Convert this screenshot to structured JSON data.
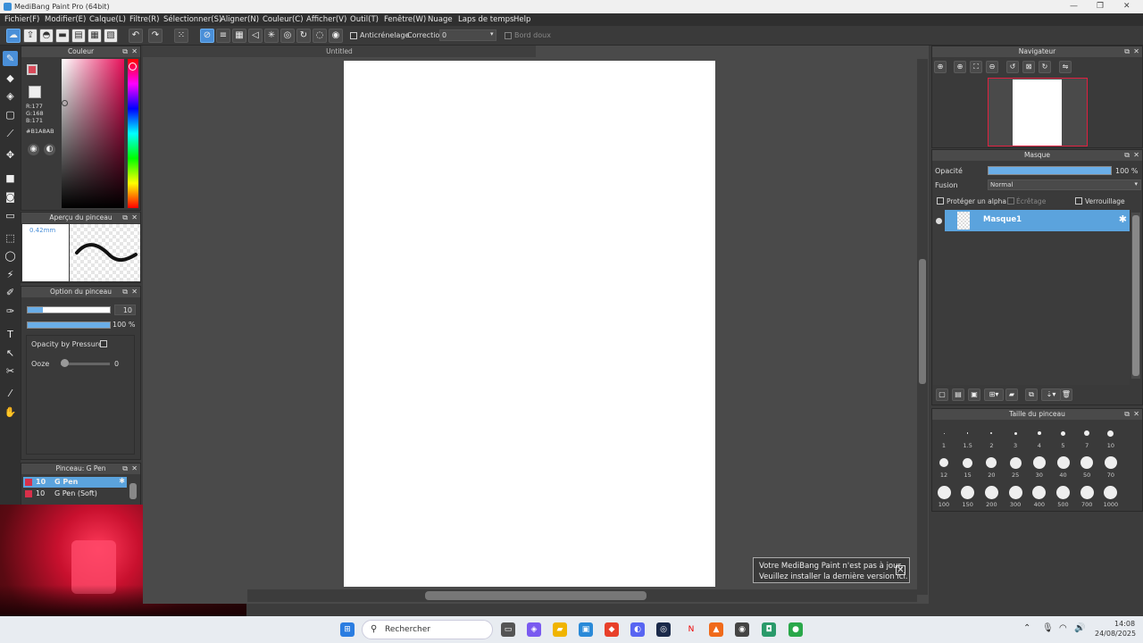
{
  "window": {
    "title": "MediBang Paint Pro (64bit)",
    "minimize": "—",
    "maximize": "❐",
    "close": "✕"
  },
  "menu": [
    "Fichier(F)",
    "Modifier(E)",
    "Calque(L)",
    "Filtre(R)",
    "Sélectionner(S)",
    "Aligner(N)",
    "Couleur(C)",
    "Afficher(V)",
    "Outil(T)",
    "Fenêtre(W)",
    "Nuage",
    "Laps de temps",
    "Help"
  ],
  "toolbar": {
    "antialias_label": "Anticrénelage",
    "correction_label": "Correction",
    "correction_value": "0",
    "soft_edge_label": "Bord doux"
  },
  "document": {
    "tab_title": "Untitled"
  },
  "color_panel": {
    "title": "Couleur",
    "r": "R:177",
    "g": "G:168",
    "b": "B:171",
    "hex": "#B1A8AB",
    "accent": "#4a8fd8"
  },
  "brush_preview": {
    "title": "Aperçu du pinceau",
    "size": "0.42mm"
  },
  "brush_option": {
    "title": "Option du pinceau",
    "size_value": "10",
    "opacity_value": "100 %",
    "opacity_by_pressure": "Opacity by Pressure",
    "ooze_label": "Ooze",
    "ooze_value": "0"
  },
  "brush_list": {
    "title": "Pinceau: G Pen",
    "items": [
      {
        "size": "10",
        "name": "G Pen"
      },
      {
        "size": "10",
        "name": "G Pen (Soft)"
      }
    ]
  },
  "navigator": {
    "title": "Navigateur"
  },
  "layer_panel": {
    "title": "Masque",
    "opacity_label": "Opacité",
    "opacity_value": "100 %",
    "blend_label": "Fusion",
    "blend_value": "Normal",
    "protect_alpha": "Protéger un alpha",
    "clipping": "Écrêtage",
    "lock": "Verrouillage",
    "layer_name": "Masque1"
  },
  "brush_size": {
    "title": "Taille du pinceau",
    "sizes": [
      "1",
      "1.5",
      "2",
      "3",
      "4",
      "5",
      "7",
      "10",
      "12",
      "15",
      "20",
      "25",
      "30",
      "40",
      "50",
      "70",
      "100",
      "150",
      "200",
      "300",
      "400",
      "500",
      "700",
      "1000"
    ]
  },
  "notification": {
    "line1": "Votre MediBang Paint n'est pas à jour.",
    "line2": "Veuillez installer la dernière version ici."
  },
  "taskbar": {
    "search_placeholder": "Rechercher",
    "time": "14:08",
    "date": "24/08/2025"
  }
}
